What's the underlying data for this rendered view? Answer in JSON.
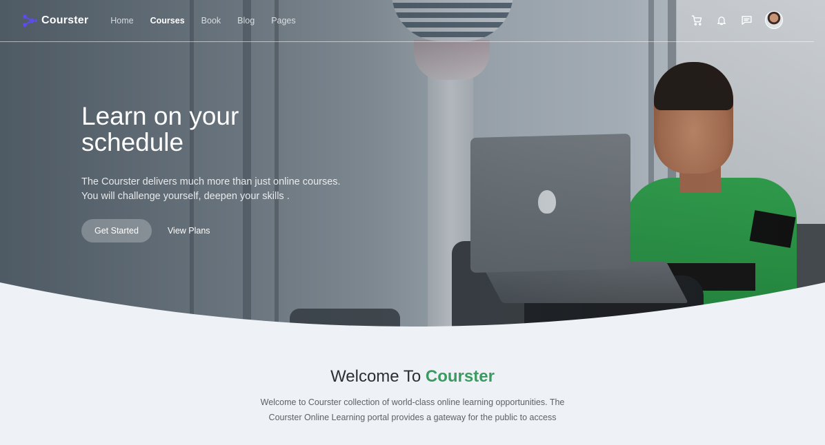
{
  "brand": {
    "name": "Courster",
    "accent_color": "#5b4ee8"
  },
  "nav": {
    "links": [
      {
        "label": "Home",
        "active": false
      },
      {
        "label": "Courses",
        "active": true
      },
      {
        "label": "Book",
        "active": false
      },
      {
        "label": "Blog",
        "active": false
      },
      {
        "label": "Pages",
        "active": false
      }
    ],
    "icons": [
      "cart-icon",
      "bell-icon",
      "message-icon",
      "avatar"
    ]
  },
  "hero": {
    "title_line1": "Learn on your",
    "title_line2": "schedule",
    "desc_line1": "The Courster delivers much more than just online courses.",
    "desc_line2": "You will challenge yourself, deepen your skills .",
    "primary_button": "Get Started",
    "secondary_button": "View Plans"
  },
  "welcome": {
    "title_prefix": "Welcome To",
    "title_accent": "Courster",
    "accent_color": "#3a9a5f",
    "text_line1": "Welcome to Courster collection of world-class online learning opportunities. The",
    "text_line2": "Courster Online Learning portal provides a gateway for the public to access"
  }
}
